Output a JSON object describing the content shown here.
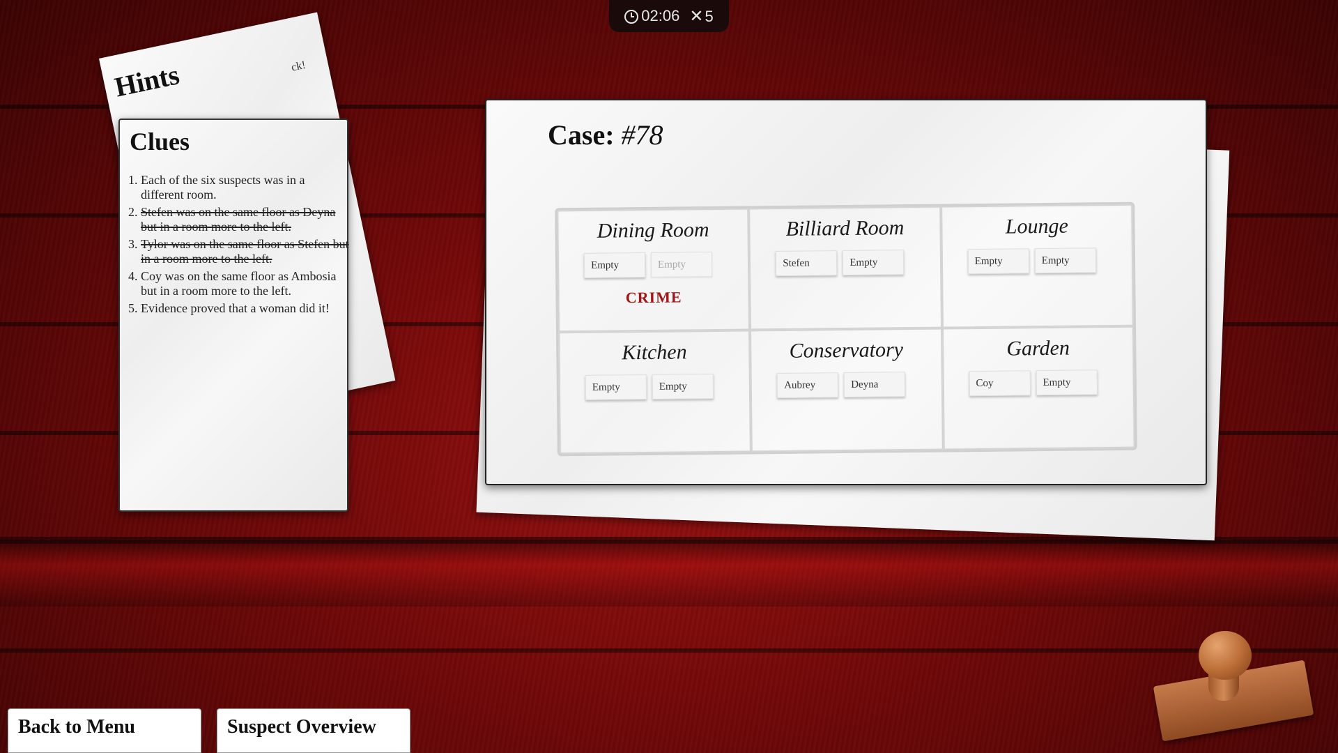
{
  "timer": {
    "time": "02:06",
    "mistakes": "5"
  },
  "hints": {
    "title": "Hints",
    "peek_text": "ck!"
  },
  "clues": {
    "title": "Clues",
    "items": [
      {
        "text": "Each of the six suspects was in a different room.",
        "done": false
      },
      {
        "text": "Stefen was on the same floor as Deyna but in a room more to the left.",
        "done": true
      },
      {
        "text": "Tylor was on the same floor as Stefen but in a room more to the left.",
        "done": true
      },
      {
        "text": "Coy was on the same floor as Ambosia but in a room more to the left.",
        "done": false
      },
      {
        "text": "Evidence proved that a woman did it!",
        "done": false
      }
    ]
  },
  "case": {
    "label": "Case: ",
    "number": "#78",
    "rooms": [
      {
        "name": "Dining Room",
        "slots": [
          "Empty",
          "Empty"
        ],
        "faded_second": true,
        "crime": "CRIME"
      },
      {
        "name": "Billiard Room",
        "slots": [
          "Stefen",
          "Empty"
        ]
      },
      {
        "name": "Lounge",
        "slots": [
          "Empty",
          "Empty"
        ]
      },
      {
        "name": "Kitchen",
        "slots": [
          "Empty",
          "Empty"
        ]
      },
      {
        "name": "Conservatory",
        "slots": [
          "Aubrey",
          "Deyna"
        ]
      },
      {
        "name": "Garden",
        "slots": [
          "Coy",
          "Empty"
        ]
      }
    ]
  },
  "buttons": {
    "back": "Back to Menu",
    "overview": "Suspect Overview"
  },
  "colors": {
    "crime": "#a01515",
    "table": "#6e0707"
  }
}
